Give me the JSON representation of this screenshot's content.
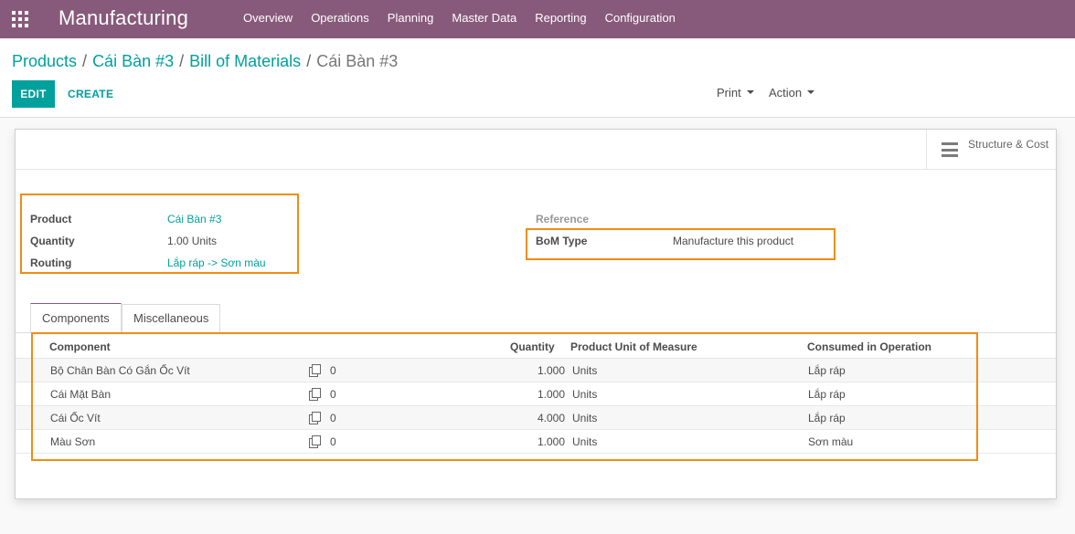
{
  "navbar": {
    "brand": "Manufacturing",
    "menu": [
      "Overview",
      "Operations",
      "Planning",
      "Master Data",
      "Reporting",
      "Configuration"
    ],
    "color": "#875a7b"
  },
  "breadcrumb": {
    "items": [
      "Products",
      "Cái Bàn #3",
      "Bill of Materials"
    ],
    "current": "Cái Bàn #3",
    "separator": "/"
  },
  "toolbar": {
    "edit_label": "EDIT",
    "create_label": "CREATE",
    "print_label": "Print",
    "action_label": "Action"
  },
  "smart_button": {
    "label": "Structure & Cost",
    "icon": "bars-icon"
  },
  "fields": {
    "product": {
      "label": "Product",
      "value": "Cái Bàn #3"
    },
    "quantity": {
      "label": "Quantity",
      "value": "1.00",
      "unit": "Units"
    },
    "routing": {
      "label": "Routing",
      "value": "Lắp ráp -> Sơn màu"
    },
    "reference": {
      "label": "Reference",
      "value": ""
    },
    "bom_type": {
      "label": "BoM Type",
      "value": "Manufacture this product"
    }
  },
  "tabs": [
    {
      "label": "Components",
      "active": true
    },
    {
      "label": "Miscellaneous",
      "active": false
    }
  ],
  "table": {
    "headers": {
      "component": "Component",
      "quantity": "Quantity",
      "uom": "Product Unit of Measure",
      "operation": "Consumed in Operation"
    },
    "rows": [
      {
        "component": "Bộ Chân Bàn Có Gắn Ốc Vít",
        "attachments": "0",
        "quantity": "1.000",
        "uom": "Units",
        "operation": "Lắp ráp"
      },
      {
        "component": "Cái Mặt Bàn",
        "attachments": "0",
        "quantity": "1.000",
        "uom": "Units",
        "operation": "Lắp ráp"
      },
      {
        "component": "Cái Ốc Vít",
        "attachments": "0",
        "quantity": "4.000",
        "uom": "Units",
        "operation": "Lắp ráp"
      },
      {
        "component": "Màu Sơn",
        "attachments": "0",
        "quantity": "1.000",
        "uom": "Units",
        "operation": "Sơn màu"
      }
    ]
  },
  "colors": {
    "accent": "#00a09d",
    "highlight": "#f08c13"
  }
}
